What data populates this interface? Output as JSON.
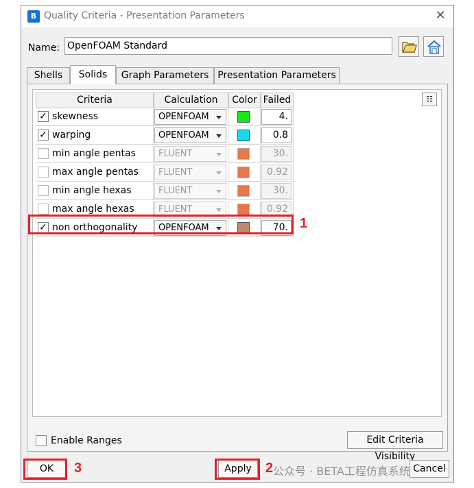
{
  "window": {
    "title": "Quality Criteria - Presentation Parameters",
    "close_glyph": "✕",
    "app_icon_letter": "B"
  },
  "name_field": {
    "label": "Name:",
    "value": "OpenFOAM Standard"
  },
  "tabs": [
    {
      "label": "Shells",
      "active": false
    },
    {
      "label": "Solids",
      "active": true
    },
    {
      "label": "Graph Parameters",
      "active": false
    },
    {
      "label": "Presentation Parameters",
      "active": false
    }
  ],
  "table": {
    "headers": {
      "criteria": "Criteria",
      "calculation": "Calculation",
      "color": "Color",
      "failed": "Failed"
    },
    "rows": [
      {
        "checked": true,
        "criteria": "skewness",
        "calculation": "OPENFOAM",
        "color": "#19e619",
        "failed": "4.",
        "enabled": true
      },
      {
        "checked": true,
        "criteria": "warping",
        "calculation": "OPENFOAM",
        "color": "#19d7f0",
        "failed": "0.8",
        "enabled": true
      },
      {
        "checked": false,
        "criteria": "min angle pentas",
        "calculation": "FLUENT",
        "color": "#e04a12",
        "failed": "30.",
        "enabled": false
      },
      {
        "checked": false,
        "criteria": "max angle pentas",
        "calculation": "FLUENT",
        "color": "#e04a12",
        "failed": "0.92",
        "enabled": false
      },
      {
        "checked": false,
        "criteria": "min angle hexas",
        "calculation": "FLUENT",
        "color": "#e04a12",
        "failed": "30.",
        "enabled": false
      },
      {
        "checked": false,
        "criteria": "max angle hexas",
        "calculation": "FLUENT",
        "color": "#e04a12",
        "failed": "0.92",
        "enabled": false
      },
      {
        "checked": true,
        "criteria": "non orthogonality",
        "calculation": "OPENFOAM",
        "color": "#c08a6a",
        "failed": "70.",
        "enabled": true
      }
    ]
  },
  "enable_ranges": {
    "label": "Enable Ranges",
    "checked": false
  },
  "buttons": {
    "edit_visibility": "Edit Criteria Visibility",
    "ok": "OK",
    "apply": "Apply",
    "cancel": "Cancel"
  },
  "annotations": {
    "n1": "1",
    "n2": "2",
    "n3": "3",
    "color": "#e2202c"
  },
  "watermark": "公众号 · BETA工程仿真系统",
  "check_glyph": "✓"
}
